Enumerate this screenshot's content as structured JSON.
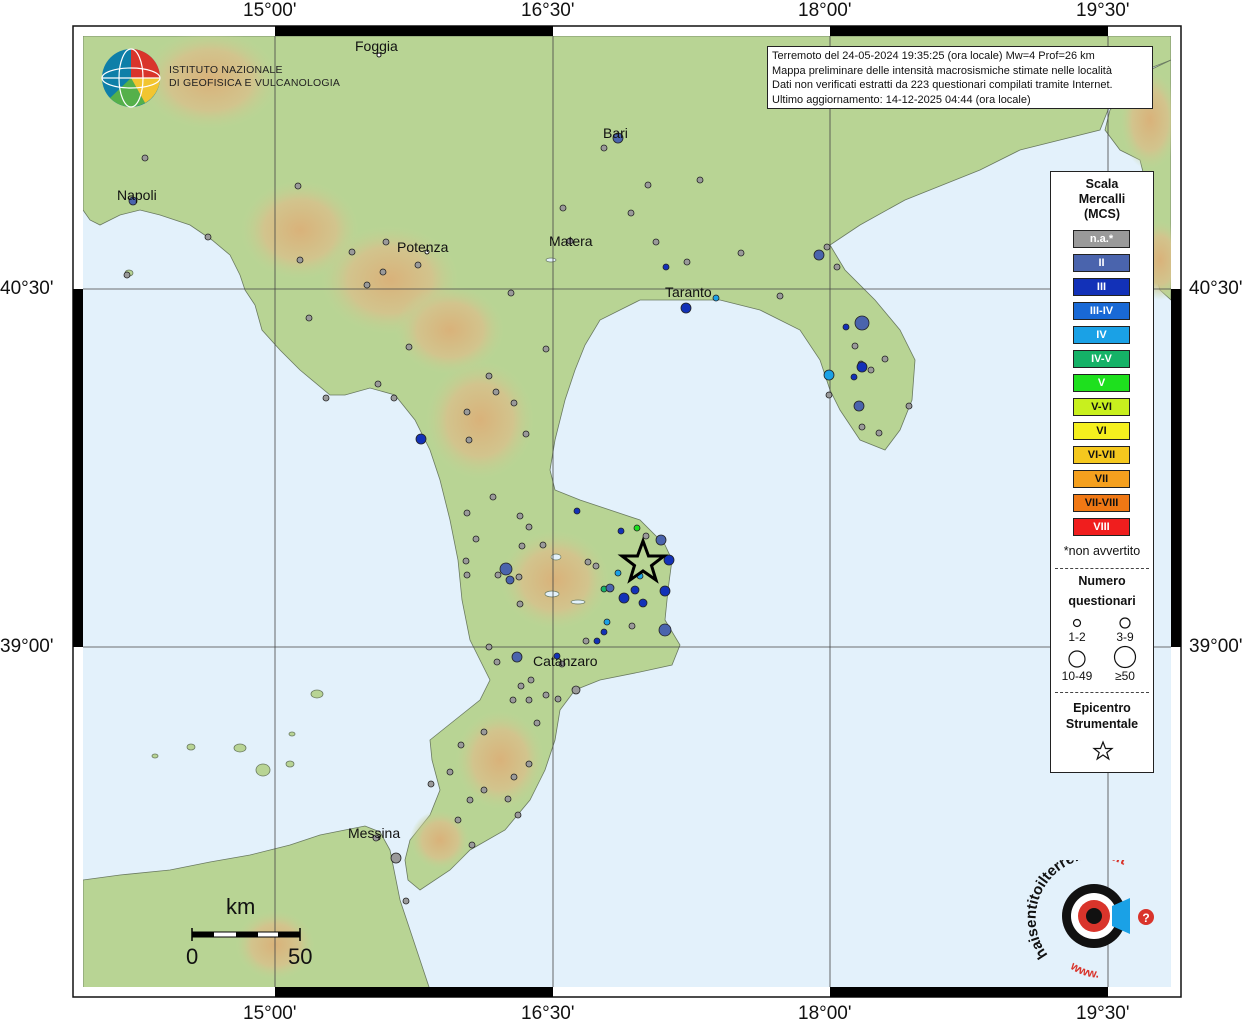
{
  "axis_labels": {
    "lon_top": [
      "15°00'",
      "16°30'",
      "18°00'",
      "19°30'"
    ],
    "lon_bottom": [
      "15°00'",
      "16°30'",
      "18°00'",
      "19°30'"
    ],
    "lat_left": [
      "40°30'",
      "39°00'"
    ],
    "lat_right": [
      "40°30'",
      "39°00'"
    ]
  },
  "info": {
    "line1": "Terremoto del 24-05-2024 19:35:25 (ora locale) Mw=4 Prof=26 km",
    "line2": "Mappa preliminare delle intensità macrosismiche stimate nelle località",
    "line3": "Dati non verificati estratti da 223 questionari compilati tramite Internet.",
    "line4": "Ultimo aggiornamento: 14-12-2025 04:44 (ora locale)"
  },
  "logo": {
    "line1": "ISTITUTO NAZIONALE",
    "line2": "DI GEOFISICA E VULCANOLOGIA"
  },
  "places": {
    "foggia": "Foggia",
    "bari": "Bari",
    "napoli": "Napoli",
    "potenza": "Potenza",
    "matera": "Matera",
    "taranto": "Taranto",
    "catanzaro": "Catanzaro",
    "messina": "Messina"
  },
  "legend": {
    "title1": "Scala",
    "title2": "Mercalli",
    "title3": "(MCS)",
    "classes": [
      {
        "label": "n.a.*",
        "color": "#9a9a9a"
      },
      {
        "label": "II",
        "color": "#4a64ad"
      },
      {
        "label": "III",
        "color": "#1231b8"
      },
      {
        "label": "III-IV",
        "color": "#1969d6"
      },
      {
        "label": "IV",
        "color": "#1aa1e6"
      },
      {
        "label": "IV-V",
        "color": "#15b267"
      },
      {
        "label": "V",
        "color": "#1ee01e"
      },
      {
        "label": "V-VI",
        "color": "#c8f01e"
      },
      {
        "label": "VI",
        "color": "#f5f01e"
      },
      {
        "label": "VI-VII",
        "color": "#f5c81e"
      },
      {
        "label": "VII",
        "color": "#f5a01e"
      },
      {
        "label": "VII-VIII",
        "color": "#f07814"
      },
      {
        "label": "VIII",
        "color": "#f01e1e"
      }
    ],
    "note": "*non avvertito",
    "count_title1": "Numero",
    "count_title2": "questionari",
    "sizes": [
      "1-2",
      "3-9",
      "10-49",
      "≥50"
    ],
    "epi_title1": "Epicentro",
    "epi_title2": "Strumentale"
  },
  "scale_bar": {
    "unit": "km",
    "min": "0",
    "max": "50"
  },
  "hst_logo": {
    "text1": "haisentitoilterremoto",
    "text2": ".it",
    "text3": "www."
  }
}
